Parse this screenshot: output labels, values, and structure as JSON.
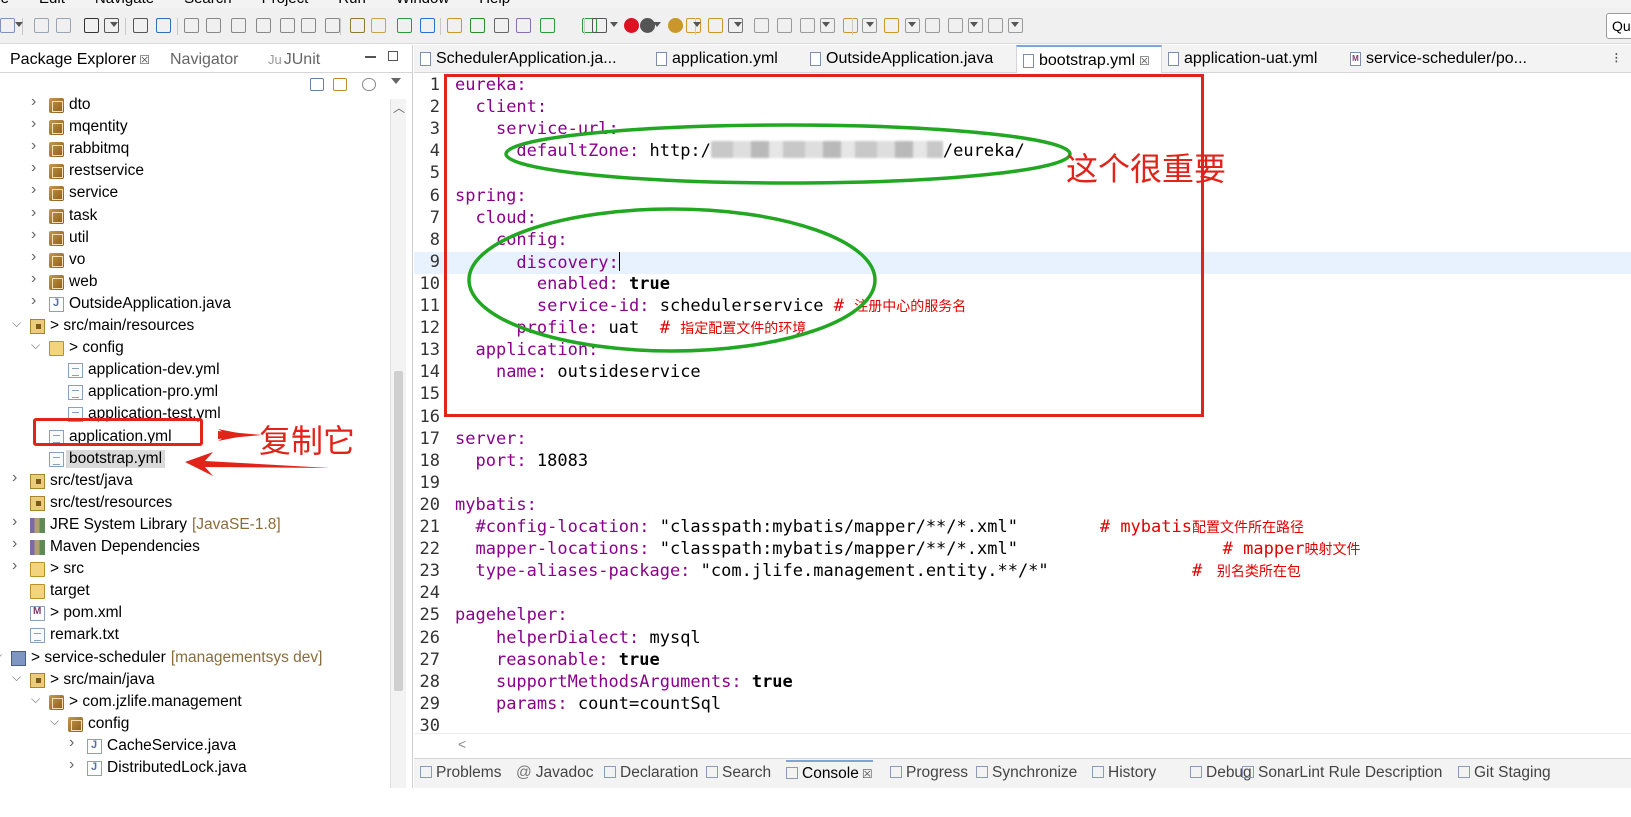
{
  "menubar": {
    "items": [
      "ile",
      "Edit",
      "Navigate",
      "Search",
      "Project",
      "Run",
      "Window",
      "Help"
    ]
  },
  "toolbar": {
    "quick_access_placeholder": "Qu"
  },
  "left_panel": {
    "tabs": [
      {
        "label": "Package Explorer",
        "active": true,
        "close": "☒"
      },
      {
        "label": "Navigator",
        "active": false
      },
      {
        "label": "JUnit",
        "prefix": "Ju",
        "active": false
      }
    ],
    "tree": [
      {
        "indent": 1,
        "arrow": ">",
        "icon": "package-icon",
        "label": "dto"
      },
      {
        "indent": 1,
        "arrow": ">",
        "icon": "package-icon",
        "label": "mqentity"
      },
      {
        "indent": 1,
        "arrow": ">",
        "icon": "package-icon",
        "label": "rabbitmq"
      },
      {
        "indent": 1,
        "arrow": ">",
        "icon": "package-icon",
        "label": "restservice"
      },
      {
        "indent": 1,
        "arrow": ">",
        "icon": "package-icon",
        "label": "service"
      },
      {
        "indent": 1,
        "arrow": ">",
        "icon": "package-icon",
        "label": "task"
      },
      {
        "indent": 1,
        "arrow": ">",
        "icon": "package-icon",
        "label": "util"
      },
      {
        "indent": 1,
        "arrow": ">",
        "icon": "package-icon",
        "label": "vo"
      },
      {
        "indent": 1,
        "arrow": ">",
        "icon": "package-icon",
        "label": "web"
      },
      {
        "indent": 1,
        "arrow": ">",
        "icon": "java-file-icon",
        "label": "OutsideApplication.java"
      },
      {
        "indent": 0,
        "arrow": "v",
        "icon": "source-folder-icon",
        "label": "> src/main/resources"
      },
      {
        "indent": 1,
        "arrow": "v",
        "icon": "folder-icon",
        "label": "> config"
      },
      {
        "indent": 2,
        "arrow": "",
        "icon": "file-icon",
        "label": "application-dev.yml"
      },
      {
        "indent": 2,
        "arrow": "",
        "icon": "file-icon",
        "label": "application-pro.yml"
      },
      {
        "indent": 2,
        "arrow": "",
        "icon": "file-icon",
        "label": "application-test.yml"
      },
      {
        "indent": 1,
        "arrow": "",
        "icon": "file-icon",
        "label": "application.yml"
      },
      {
        "indent": 1,
        "arrow": "",
        "icon": "file-icon",
        "label": "bootstrap.yml",
        "selected": true
      },
      {
        "indent": 0,
        "arrow": ">",
        "icon": "source-folder-icon",
        "label": "src/test/java"
      },
      {
        "indent": 0,
        "arrow": "",
        "icon": "source-folder-icon",
        "label": "src/test/resources"
      },
      {
        "indent": 0,
        "arrow": ">",
        "icon": "library-icon",
        "label": "JRE System Library",
        "deco": "[JavaSE-1.8]"
      },
      {
        "indent": 0,
        "arrow": ">",
        "icon": "library-icon",
        "label": "Maven Dependencies"
      },
      {
        "indent": 0,
        "arrow": ">",
        "icon": "folder-icon",
        "label": "> src"
      },
      {
        "indent": 0,
        "arrow": "",
        "icon": "folder-icon",
        "label": "target"
      },
      {
        "indent": 0,
        "arrow": "",
        "icon": "pom-file-icon",
        "label": "> pom.xml"
      },
      {
        "indent": 0,
        "arrow": "",
        "icon": "file-icon",
        "label": "remark.txt"
      },
      {
        "indent": -1,
        "arrow": "v",
        "icon": "project-icon",
        "label": "> service-scheduler",
        "deco": "[managementsys dev]"
      },
      {
        "indent": 0,
        "arrow": "v",
        "icon": "source-folder-icon",
        "label": "> src/main/java"
      },
      {
        "indent": 1,
        "arrow": "v",
        "icon": "package-icon",
        "label": "> com.jzlife.management"
      },
      {
        "indent": 2,
        "arrow": "v",
        "icon": "package-icon",
        "label": "config"
      },
      {
        "indent": 3,
        "arrow": ">",
        "icon": "java-file-icon",
        "label": "CacheService.java"
      },
      {
        "indent": 3,
        "arrow": ">",
        "icon": "java-file-icon",
        "label": "DistributedLock.java"
      }
    ],
    "annotation_label": "复制它"
  },
  "editor": {
    "tabs": [
      {
        "label": "SchedulerApplication.ja...",
        "icon": "java-file-icon"
      },
      {
        "label": "application.yml",
        "icon": "file-icon"
      },
      {
        "label": "OutsideApplication.java",
        "icon": "java-file-icon"
      },
      {
        "label": "bootstrap.yml",
        "icon": "file-icon",
        "active": true,
        "close": "☒"
      },
      {
        "label": "application-uat.yml",
        "icon": "file-icon"
      },
      {
        "label": "service-scheduler/po...",
        "icon": "pom-file-icon"
      }
    ],
    "lines": [
      {
        "n": "1",
        "key": "eureka:"
      },
      {
        "n": "2",
        "indent": "  ",
        "key": "client:"
      },
      {
        "n": "3",
        "indent": "    ",
        "key": "service-url:"
      },
      {
        "n": "4",
        "indent": "      ",
        "key": "defaultZone:",
        "value_prefix": " http:/",
        "blurred": true,
        "value_suffix": "/eureka/"
      },
      {
        "n": "5"
      },
      {
        "n": "6",
        "key": "spring:"
      },
      {
        "n": "7",
        "indent": "  ",
        "key": "cloud:"
      },
      {
        "n": "8",
        "indent": "    ",
        "key": "config:"
      },
      {
        "n": "9",
        "indent": "      ",
        "key": "discovery:",
        "current": true
      },
      {
        "n": "10",
        "indent": "        ",
        "key": "enabled:",
        "bold": " true"
      },
      {
        "n": "11",
        "indent": "        ",
        "key": "service-id:",
        "value": " schedulerservice ",
        "comment": "# ",
        "comment_cn": "注册中心的服务名"
      },
      {
        "n": "12",
        "indent": "      ",
        "key": "profile:",
        "value": " uat  ",
        "comment": "# ",
        "comment_cn": "指定配置文件的环境"
      },
      {
        "n": "13",
        "indent": "  ",
        "key": "application:"
      },
      {
        "n": "14",
        "indent": "    ",
        "key": "name:",
        "value": " outsideservice"
      },
      {
        "n": "15"
      },
      {
        "n": "16"
      },
      {
        "n": "17",
        "key": "server:"
      },
      {
        "n": "18",
        "indent": "  ",
        "key": "port:",
        "value": " 18083"
      },
      {
        "n": "19"
      },
      {
        "n": "20",
        "key": "mybatis:"
      },
      {
        "n": "21",
        "indent": "  ",
        "key": "#config-location:",
        "key_is_comment": true,
        "string": " \"classpath:mybatis/mapper/**/*.xml\"",
        "gap": "        ",
        "comment": "# mybatis",
        "comment_cn": "配置文件所在路径"
      },
      {
        "n": "22",
        "indent": "  ",
        "key": "mapper-locations:",
        "value": " \"classpath:mybatis/mapper/**/*.xml\"",
        "gap": "                    ",
        "comment": "# mapper",
        "comment_cn": "映射文件"
      },
      {
        "n": "23",
        "indent": "  ",
        "key": "type-aliases-package:",
        "value": " \"com.jlife.management.entity.**/*\"",
        "gap": "              ",
        "comment": "# ",
        "comment_cn": " 别名类所在包"
      },
      {
        "n": "24"
      },
      {
        "n": "25",
        "key": "pagehelper:"
      },
      {
        "n": "26",
        "indent": "    ",
        "key": "helperDialect:",
        "value": " mysql"
      },
      {
        "n": "27",
        "indent": "    ",
        "key": "reasonable:",
        "bold": " true"
      },
      {
        "n": "28",
        "indent": "    ",
        "key": "supportMethodsArguments:",
        "bold": " true"
      },
      {
        "n": "29",
        "indent": "    ",
        "key": "params:",
        "value": " count=countSql"
      },
      {
        "n": "30"
      }
    ],
    "annotation_label": "这个很重要",
    "hscroll_arrow": "<"
  },
  "bottom_tabs": [
    {
      "label": "Problems"
    },
    {
      "label": "Javadoc",
      "prefix": "@"
    },
    {
      "label": "Declaration"
    },
    {
      "label": "Search"
    },
    {
      "label": "Console",
      "active": true,
      "close": "☒"
    },
    {
      "label": "Progress"
    },
    {
      "label": "Synchronize"
    },
    {
      "label": "History"
    },
    {
      "label": "Debug"
    },
    {
      "label": "SonarLint Rule Description"
    },
    {
      "label": "Git Staging"
    }
  ],
  "colors": {
    "annotation_red": "#e0241a",
    "annotation_green": "#22a722",
    "yaml_key": "#8b008b",
    "comment": "#e00000",
    "current_line": "#e8f2fe"
  }
}
